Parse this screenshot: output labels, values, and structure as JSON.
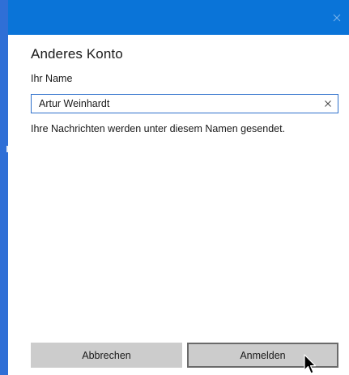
{
  "dialog": {
    "heading": "Anderes Konto",
    "name_label": "Ihr Name",
    "name_value": "Artur Weinhardt",
    "info_text": "Ihre Nachrichten werden unter diesem Namen gesendet.",
    "cancel_label": "Abbrechen",
    "signin_label": "Anmelden"
  },
  "icons": {
    "window_close": "close-icon",
    "input_clear": "clear-icon",
    "pointer": "mouse-pointer-icon"
  },
  "colors": {
    "titlebar": "#0a74d8",
    "window_edge": "#2f6fd6",
    "input_focus_border": "#2f71cc",
    "button_bg": "#cccccc",
    "button_focus_border": "#6a6a6a"
  }
}
